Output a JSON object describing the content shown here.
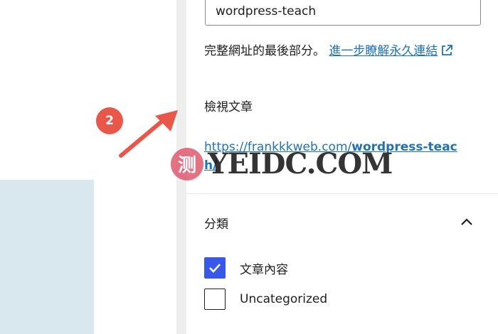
{
  "slug": {
    "value": "wordpress-teach"
  },
  "helper": {
    "text": "完整網址的最後部分。 ",
    "link_label": "進一步瞭解永久連結"
  },
  "view_post": {
    "label": "檢視文章",
    "url_prefix": "https://frankkkweb.com/",
    "url_bold": "wordpress-teach/"
  },
  "categories_panel": {
    "title": "分類",
    "items": [
      {
        "label": "文章內容",
        "checked": true
      },
      {
        "label": "Uncategorized",
        "checked": false
      }
    ]
  },
  "annotation": {
    "step_number": "2"
  },
  "watermark": {
    "badge": "测",
    "text": "YEIDC.COM"
  },
  "colors": {
    "link": "#2271b1",
    "checkbox_checked": "#3858e9",
    "annotation": "#e8584a",
    "left_block": "#d9e7ef"
  },
  "icons": [
    "external-link-icon",
    "chevron-up-icon",
    "check-icon",
    "arrow-icon"
  ]
}
